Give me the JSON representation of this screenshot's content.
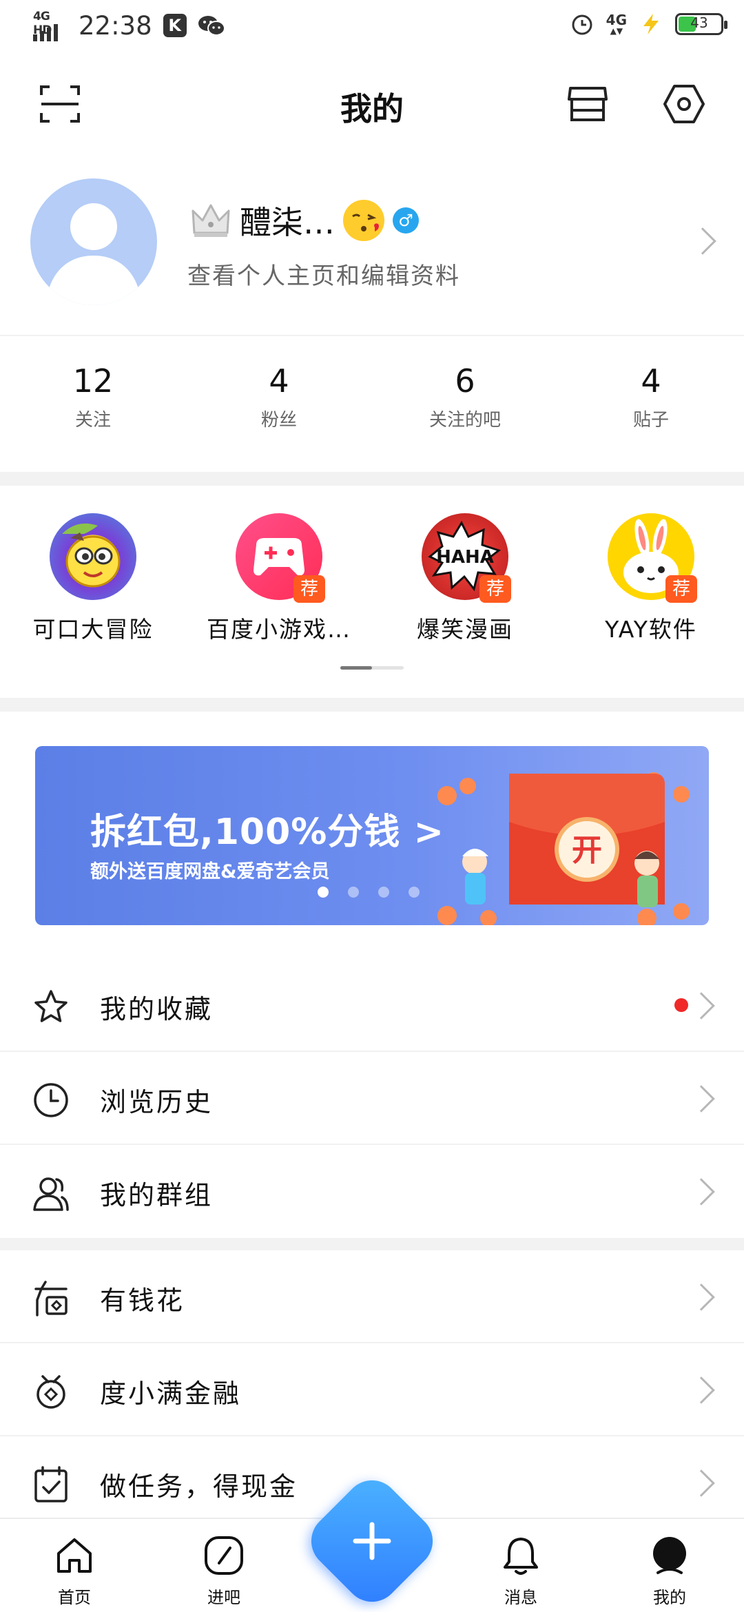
{
  "status_bar": {
    "network": "4G HD",
    "time": "22:38",
    "app_k_label": "K",
    "network_right": "4G",
    "battery_level": "43",
    "battery_fraction": 0.43
  },
  "header": {
    "title": "我的"
  },
  "profile": {
    "name": "醴柒…",
    "subtitle": "查看个人主页和编辑资料",
    "gender_symbol": "♂"
  },
  "stats": [
    {
      "value": "12",
      "label": "关注"
    },
    {
      "value": "4",
      "label": "粉丝"
    },
    {
      "value": "6",
      "label": "关注的吧"
    },
    {
      "value": "4",
      "label": "贴子"
    }
  ],
  "apps": [
    {
      "label": "可口大冒险",
      "badge": ""
    },
    {
      "label": "百度小游戏…",
      "badge": "荐"
    },
    {
      "label": "爆笑漫画",
      "badge": "荐",
      "icon_text": "HAHA"
    },
    {
      "label": "YAY软件",
      "badge": "荐"
    }
  ],
  "banner": {
    "title": "拆红包,100%分钱 >",
    "subtitle": "额外送百度网盘&爱奇艺会员",
    "envelope_text": "开",
    "active_dot": 0,
    "dot_count": 4
  },
  "menu_group_1": [
    {
      "label": "我的收藏",
      "icon": "star-icon",
      "has_red_dot": true
    },
    {
      "label": "浏览历史",
      "icon": "clock-icon",
      "has_red_dot": false
    },
    {
      "label": "我的群组",
      "icon": "group-icon",
      "has_red_dot": false
    }
  ],
  "menu_group_2": [
    {
      "label": "有钱花",
      "icon": "youqianhua-icon"
    },
    {
      "label": "度小满金融",
      "icon": "finance-icon"
    },
    {
      "label": "做任务，得现金",
      "icon": "task-icon"
    }
  ],
  "bottom_nav": [
    {
      "label": "首页",
      "icon": "home-icon"
    },
    {
      "label": "进吧",
      "icon": "compass-icon"
    },
    {
      "label": "消息",
      "icon": "bell-icon"
    },
    {
      "label": "我的",
      "icon": "me-icon",
      "active": true
    }
  ],
  "colors": {
    "accent_blue": "#2f7cff",
    "badge_orange": "#ff5a1f",
    "red_dot": "#f02828",
    "battery_green": "#3bc34a"
  }
}
